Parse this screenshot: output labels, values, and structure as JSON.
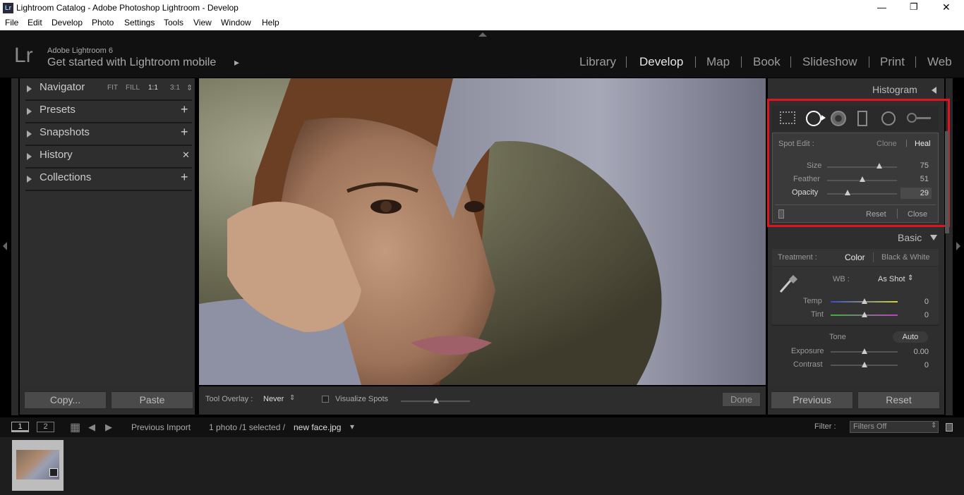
{
  "window": {
    "title": "Lightroom Catalog - Adobe Photoshop Lightroom - Develop",
    "logo_text": "Lr",
    "controls": {
      "minimize": "—",
      "maximize": "❐",
      "close": "✕"
    }
  },
  "menu": [
    "File",
    "Edit",
    "Develop",
    "Photo",
    "Settings",
    "Tools",
    "View",
    "Window",
    "Help"
  ],
  "identity": {
    "logo": "Lr",
    "product": "Adobe Lightroom 6",
    "mobile": "Get started with Lightroom mobile",
    "mobile_arrow": "▸"
  },
  "modules": [
    "Library",
    "Develop",
    "Map",
    "Book",
    "Slideshow",
    "Print",
    "Web"
  ],
  "active_module": "Develop",
  "left_panel": {
    "navigator": {
      "label": "Navigator",
      "fit": "FIT",
      "fill": "FILL",
      "one": "1:1",
      "three": "3:1",
      "stepper": "⇕"
    },
    "presets": {
      "label": "Presets",
      "action": "+"
    },
    "snapshots": {
      "label": "Snapshots",
      "action": "+"
    },
    "history": {
      "label": "History",
      "action": "✕"
    },
    "collections": {
      "label": "Collections",
      "action": "+"
    },
    "copy": "Copy...",
    "paste": "Paste"
  },
  "right_panel": {
    "histogram": "Histogram",
    "spot_edit": {
      "label": "Spot Edit :",
      "clone": "Clone",
      "divider": "|",
      "heal": "Heal",
      "size_label": "Size",
      "size": 75,
      "feather_label": "Feather",
      "feather": 51,
      "opacity_label": "Opacity",
      "opacity": 29,
      "reset": "Reset",
      "close": "Close"
    },
    "basic": "Basic",
    "treatment_label": "Treatment :",
    "color": "Color",
    "bw": "Black & White",
    "wb_label": "WB :",
    "wb_value": "As Shot",
    "wb_arrow": "⇕",
    "temp_label": "Temp",
    "temp": "0",
    "tint_label": "Tint",
    "tint": "0",
    "tone": "Tone",
    "auto": "Auto",
    "exposure_label": "Exposure",
    "exposure": "0.00",
    "contrast_label": "Contrast",
    "contrast": "0",
    "previous": "Previous",
    "reset": "Reset"
  },
  "toolbar": {
    "overlay_label": "Tool Overlay :",
    "overlay_value": "Never",
    "overlay_arrow": "⇕",
    "visualize": "Visualize Spots",
    "done": "Done"
  },
  "filmstrip": {
    "view1": "1",
    "view2": "2",
    "grid": "▦",
    "back": "◀",
    "forward": "▶",
    "source": "Previous Import",
    "count": "1 photo /1 selected /",
    "filename": "new face.jpg",
    "filename_arrow": "▾",
    "filter_label": "Filter :",
    "filter_value": "Filters Off",
    "filter_arrow": "⇕"
  },
  "colors": {
    "accent_red": "#e0141e",
    "panel": "#2e2e2e",
    "background": "#000000"
  }
}
